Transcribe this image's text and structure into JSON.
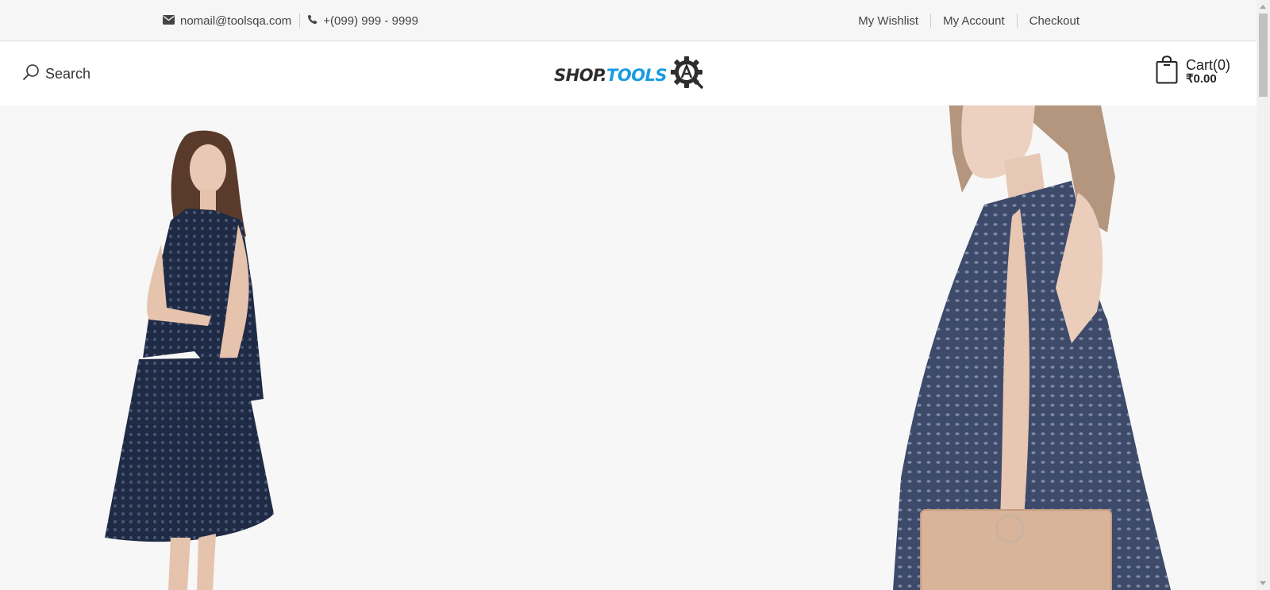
{
  "topbar": {
    "email": "nomail@toolsqa.com",
    "phone": "+(099) 999 - 9999",
    "links": {
      "wishlist": "My Wishlist",
      "account": "My Account",
      "checkout": "Checkout"
    }
  },
  "header": {
    "search_label": "Search",
    "logo": {
      "part1": "SHOP.",
      "part2": "TOOLS",
      "colors": {
        "dark": "#2e2e2e",
        "accent": "#1a9be0"
      }
    },
    "cart": {
      "label": "Cart(0)",
      "amount": "₹0.00"
    }
  },
  "hero": {
    "background": "#f7f7f7",
    "dress_color": "#1f2a44"
  },
  "icons": {
    "email": "envelope-icon",
    "phone": "phone-icon",
    "search": "search-icon",
    "cart": "shopping-bag-icon",
    "logo": "gear-icon"
  }
}
